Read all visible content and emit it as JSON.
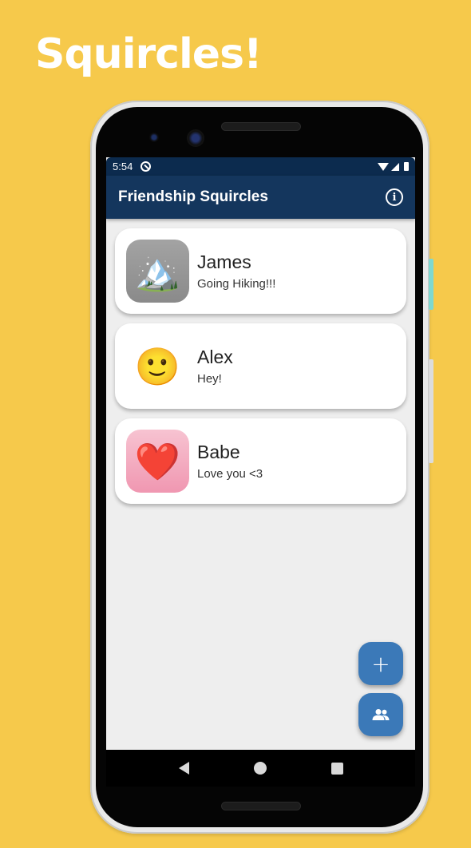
{
  "promo": {
    "title": "Squircles!"
  },
  "status_bar": {
    "time": "5:54"
  },
  "app_bar": {
    "title": "Friendship Squircles",
    "info_icon": "info-icon",
    "info_glyph": "i"
  },
  "friends": [
    {
      "name": "James",
      "status": "Going Hiking!!!",
      "avatar_emoji": "🏔️",
      "avatar_bg": "#9a9a9a"
    },
    {
      "name": "Alex",
      "status": "Hey!",
      "avatar_emoji": "🙂",
      "avatar_bg": "#ffffff"
    },
    {
      "name": "Babe",
      "status": "Love you <3",
      "avatar_emoji": "❤️",
      "avatar_bg": "#f4adc2"
    }
  ],
  "fabs": {
    "add_icon": "add-icon",
    "add_glyph": "+",
    "group_icon": "group-icon"
  },
  "colors": {
    "background": "#F6C94B",
    "app_bar": "#14365d",
    "status_bar": "#0c2b4e",
    "fab": "#3b79b8"
  }
}
